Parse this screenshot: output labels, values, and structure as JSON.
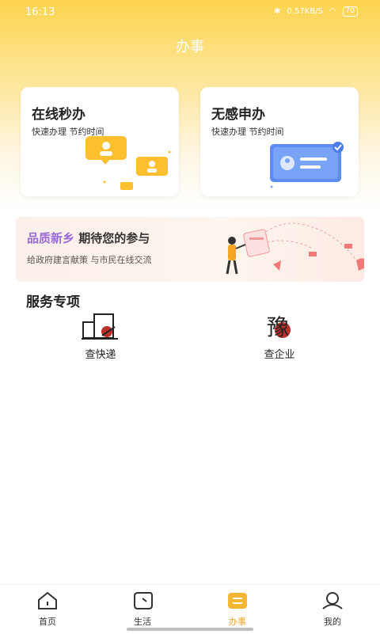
{
  "status": {
    "time": "16:13",
    "network_speed": "0.57",
    "network_unit": "KB/S",
    "battery": "70"
  },
  "header": {
    "title": "办事"
  },
  "cards": [
    {
      "title": "在线秒办",
      "subtitle": "快速办理 节约时间"
    },
    {
      "title": "无感申办",
      "subtitle": "快速办理 节约时间"
    }
  ],
  "banner": {
    "title_highlight": "品质新乡",
    "title_rest": " 期待您的参与",
    "subtitle": "给政府建言献策 与市民在线交流"
  },
  "services": {
    "section_title": "服务专项",
    "items": [
      {
        "label": "查快递"
      },
      {
        "label": "查企业"
      }
    ]
  },
  "tabbar": {
    "items": [
      {
        "label": "首页"
      },
      {
        "label": "生活"
      },
      {
        "label": "办事"
      },
      {
        "label": "我的"
      }
    ],
    "active": "办事"
  },
  "colors": {
    "accent": "#f5a623",
    "hero_yellow": "#fdd44f",
    "banner_purple": "#9a6ad8"
  }
}
